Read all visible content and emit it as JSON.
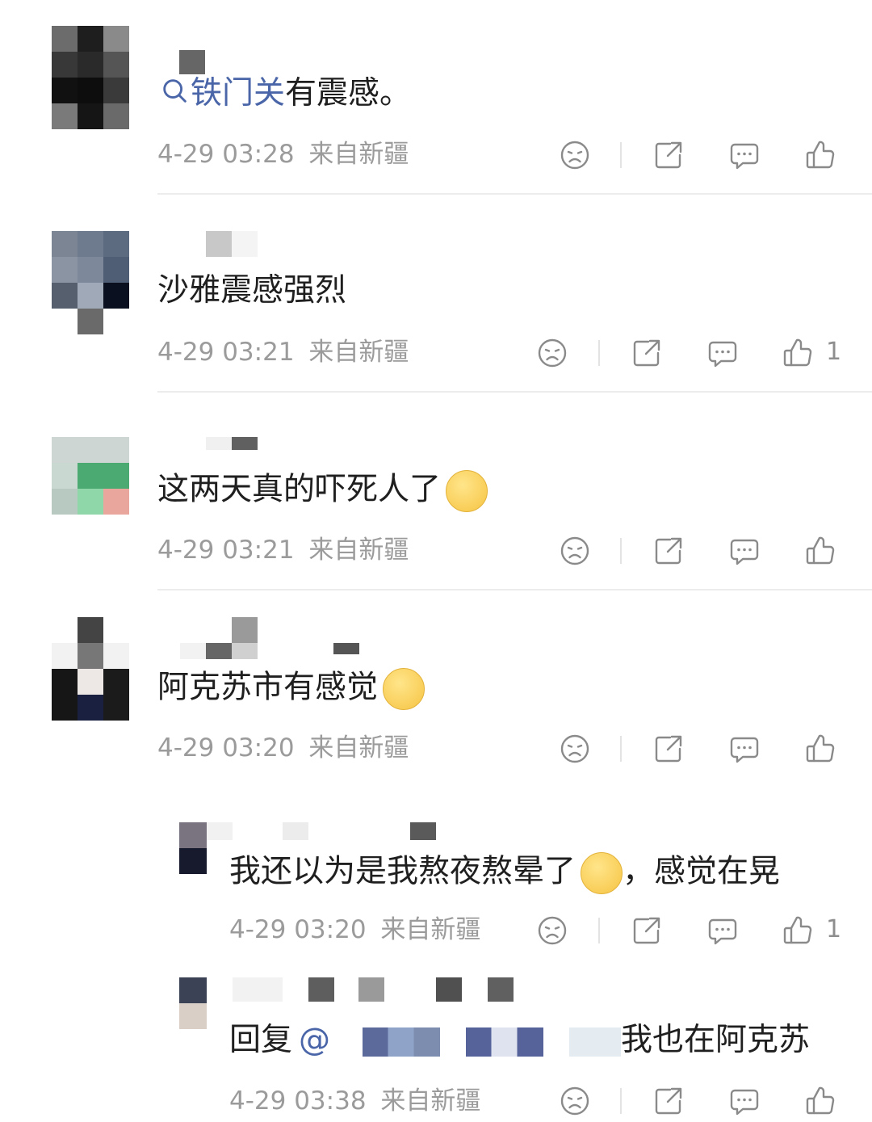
{
  "comments": [
    {
      "text_link": "铁门关",
      "text": "有震感。",
      "time": "4-29 03:28",
      "location": "来自新疆",
      "likes": ""
    },
    {
      "text": "沙雅震感强烈",
      "time": "4-29 03:21",
      "location": "来自新疆",
      "likes": "1"
    },
    {
      "text": "这两天真的吓死人了",
      "emoji": "smirk-face-emoji",
      "time": "4-29 03:21",
      "location": "来自新疆",
      "likes": ""
    },
    {
      "text": "阿克苏市有感觉",
      "emoji": "crying-face-emoji",
      "time": "4-29 03:20",
      "location": "来自新疆",
      "likes": ""
    }
  ],
  "replies": [
    {
      "text_before": "我还以为是我熬夜熬晕了",
      "emoji": "crying-face-emoji",
      "text_after": "，感觉在晃",
      "time": "4-29 03:20",
      "location": "来自新疆",
      "likes": "1"
    },
    {
      "prefix": "回复",
      "at": "@",
      "text": "我也在阿克苏",
      "time": "4-29 03:38",
      "location": "来自新疆",
      "likes": ""
    }
  ],
  "icons": {
    "dislike": "frown-face-icon",
    "repost": "share-out-icon",
    "comment": "comment-bubble-icon",
    "like": "thumbs-up-icon"
  },
  "colors": {
    "text": "#1f1f1f",
    "meta": "#9b9b9b",
    "link": "#4a66a8",
    "divider": "#ececec"
  }
}
